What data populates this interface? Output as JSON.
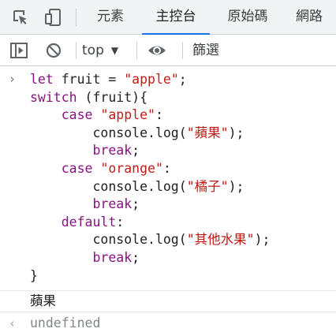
{
  "tabs": [
    {
      "label": "元素",
      "active": false
    },
    {
      "label": "主控台",
      "active": true
    },
    {
      "label": "原始碼",
      "active": false
    },
    {
      "label": "網路",
      "active": false
    }
  ],
  "toolbar": {
    "context": "top",
    "filter_placeholder": "篩選"
  },
  "console": {
    "input_prompt": "›",
    "code_lines": [
      [
        {
          "t": "let ",
          "c": "kw"
        },
        {
          "t": "fruit = ",
          "c": "plain"
        },
        {
          "t": "\"apple\"",
          "c": "str"
        },
        {
          "t": ";",
          "c": "plain"
        }
      ],
      [
        {
          "t": "switch",
          "c": "kw"
        },
        {
          "t": " (fruit){",
          "c": "plain"
        }
      ],
      [
        {
          "t": "    ",
          "c": "plain"
        },
        {
          "t": "case",
          "c": "kw"
        },
        {
          "t": " ",
          "c": "plain"
        },
        {
          "t": "\"apple\"",
          "c": "str"
        },
        {
          "t": ":",
          "c": "plain"
        }
      ],
      [
        {
          "t": "        console.log(",
          "c": "plain"
        },
        {
          "t": "\"蘋果\"",
          "c": "str"
        },
        {
          "t": ");",
          "c": "plain"
        }
      ],
      [
        {
          "t": "        ",
          "c": "plain"
        },
        {
          "t": "break",
          "c": "kw"
        },
        {
          "t": ";",
          "c": "plain"
        }
      ],
      [
        {
          "t": "    ",
          "c": "plain"
        },
        {
          "t": "case",
          "c": "kw"
        },
        {
          "t": " ",
          "c": "plain"
        },
        {
          "t": "\"orange\"",
          "c": "str"
        },
        {
          "t": ":",
          "c": "plain"
        }
      ],
      [
        {
          "t": "        console.log(",
          "c": "plain"
        },
        {
          "t": "\"橘子\"",
          "c": "str"
        },
        {
          "t": ");",
          "c": "plain"
        }
      ],
      [
        {
          "t": "        ",
          "c": "plain"
        },
        {
          "t": "break",
          "c": "kw"
        },
        {
          "t": ";",
          "c": "plain"
        }
      ],
      [
        {
          "t": "    ",
          "c": "plain"
        },
        {
          "t": "default",
          "c": "kw"
        },
        {
          "t": ":",
          "c": "plain"
        }
      ],
      [
        {
          "t": "        console.log(",
          "c": "plain"
        },
        {
          "t": "\"其他水果\"",
          "c": "str"
        },
        {
          "t": ");",
          "c": "plain"
        }
      ],
      [
        {
          "t": "        ",
          "c": "plain"
        },
        {
          "t": "break",
          "c": "kw"
        },
        {
          "t": ";",
          "c": "plain"
        }
      ],
      [
        {
          "t": "}",
          "c": "plain"
        }
      ]
    ],
    "log_output": "蘋果",
    "result_prompt": "‹",
    "result": "undefined"
  },
  "icons": {
    "inspect": "inspect-element-icon",
    "device": "device-toolbar-icon",
    "sidebar": "show-sidebar-icon",
    "clear": "clear-console-icon",
    "eye": "live-expression-eye-icon"
  },
  "colors": {
    "keyword": "#881280",
    "string": "#c41a16",
    "tab_underline": "#1a73e8",
    "toolbar_bg": "#f1f3f4"
  }
}
